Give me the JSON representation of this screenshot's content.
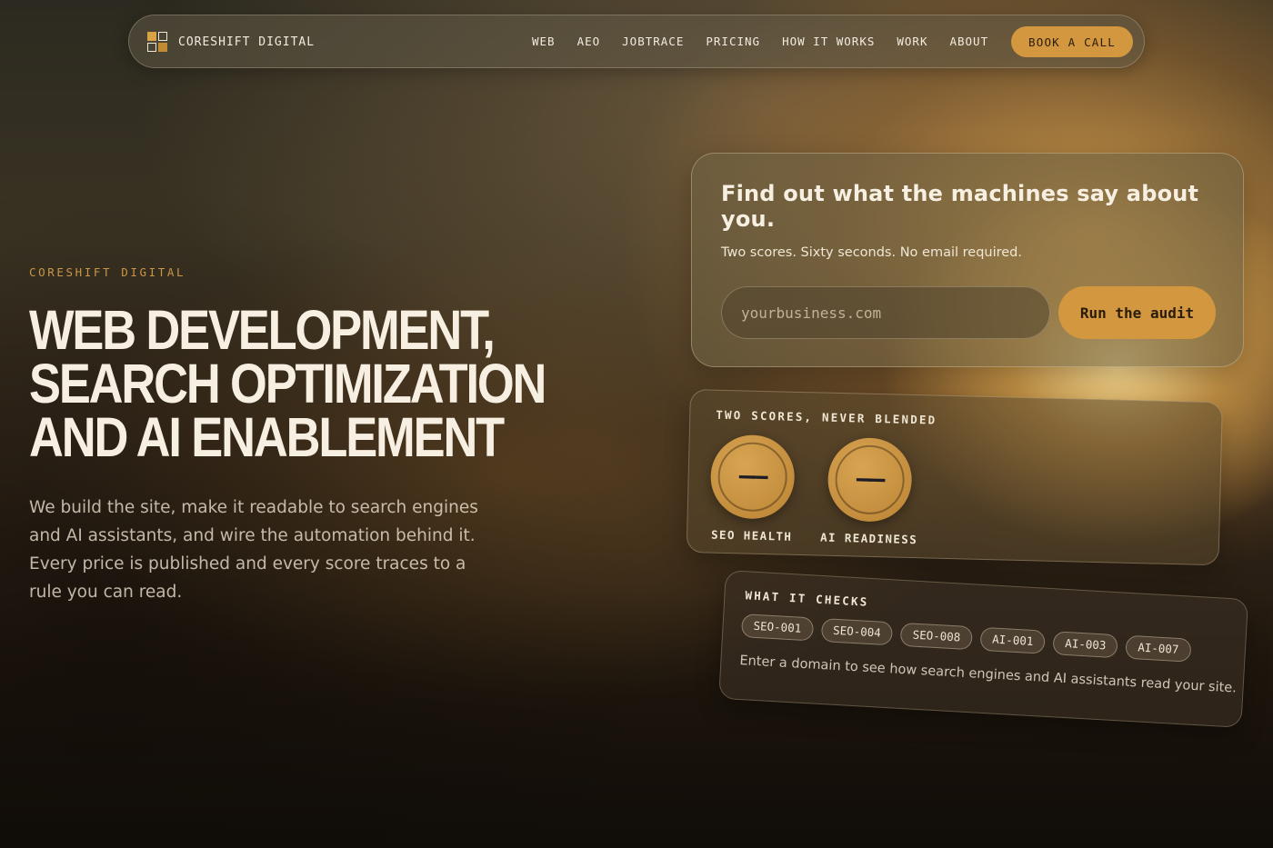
{
  "nav": {
    "brand": "COREShIFT DIGITAL",
    "links": [
      "WEB",
      "AEO",
      "JOBTRACE",
      "PRICING",
      "HOW IT WORKS",
      "WORK",
      "ABOUT"
    ],
    "cta": "BOOK A CALL"
  },
  "hero": {
    "eyebrow": "CORESHIFT DIGITAL",
    "headline": [
      "WEB DEVELOPMENT,",
      "SEARCH OPTIMIZATION",
      "AND AI ENABLEMENT"
    ],
    "lede": "We build the site, make it readable to search engines and AI assistants, and wire the automation behind it. Every price is published and every score traces to a rule you can read."
  },
  "audit": {
    "title": "Find out what the machines say about you.",
    "subtitle": "Two scores. Sixty seconds. No email required.",
    "input_placeholder": "yourbusiness.com",
    "button": "Run the audit"
  },
  "scores": {
    "title": "TWO SCORES, NEVER BLENDED",
    "items": [
      {
        "label": "SEO HEALTH",
        "value": "——"
      },
      {
        "label": "AI READINESS",
        "value": "——"
      }
    ]
  },
  "checks": {
    "title": "WHAT IT CHECKS",
    "rules": [
      "SEO-001",
      "SEO-004",
      "SEO-008",
      "AI-001",
      "AI-003",
      "AI-007"
    ],
    "note": "Enter a domain to see how search engines and AI assistants read your site."
  },
  "colors": {
    "accent": "#d2973f",
    "eyebrow": "#c99548",
    "text": "#f3ece0"
  }
}
